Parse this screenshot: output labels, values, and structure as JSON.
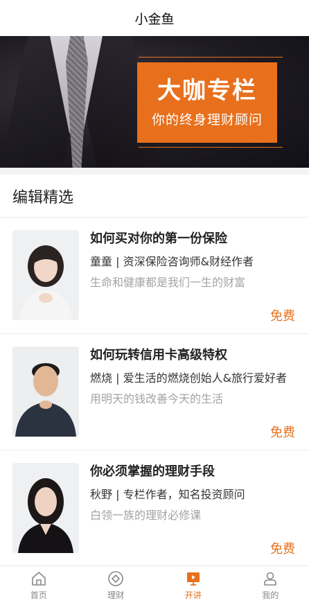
{
  "header": {
    "title": "小金鱼"
  },
  "banner": {
    "headline": "大咖专栏",
    "subtitle": "你的终身理财顾问",
    "accent": "#e8701c"
  },
  "section": {
    "title": "编辑精选",
    "items": [
      {
        "title": "如何买对你的第一份保险",
        "author": "童童 | 资深保险咨询师&财经作者",
        "desc": "生命和健康都是我们一生的财富",
        "price": "免费"
      },
      {
        "title": "如何玩转信用卡高级特权",
        "author": "燃烧 | 爱生活的燃烧创始人&旅行爱好者",
        "desc": "用明天的钱改善今天的生活",
        "price": "免费"
      },
      {
        "title": "你必须掌握的理财手段",
        "author": "秋野 | 专栏作者，知名投资顾问",
        "desc": "白领一族的理财必修课",
        "price": "免费"
      }
    ]
  },
  "tabbar": {
    "items": [
      {
        "label": "首页",
        "icon": "home-icon"
      },
      {
        "label": "理财",
        "icon": "finance-icon"
      },
      {
        "label": "开讲",
        "icon": "video-lecture-icon",
        "active": true
      },
      {
        "label": "我的",
        "icon": "user-icon"
      }
    ]
  }
}
